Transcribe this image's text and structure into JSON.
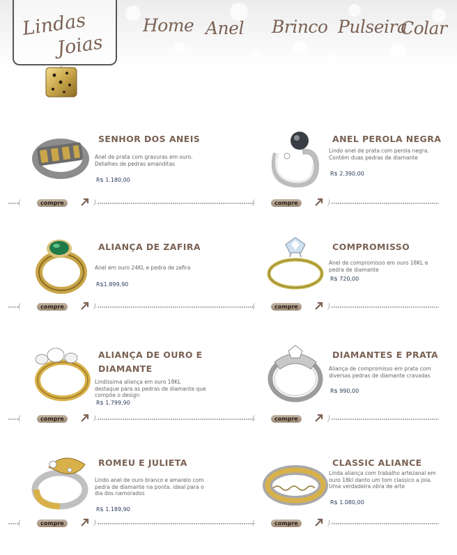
{
  "logo": {
    "line1": "Lindas",
    "line2": "Joias"
  },
  "nav": {
    "home": "Home",
    "anel": "Anel",
    "brinco": "Brinco",
    "pulseira": "Pulseira",
    "colar": "Colar"
  },
  "ui": {
    "buy_label": "compre",
    "arrow_icon": "arrow-up-right-icon",
    "accent_color": "#7a6254"
  },
  "products": [
    {
      "name": "SENHOR DOS ANEIS",
      "description": "Anel de prata com gravuras em ouro. Detalhes de pedras amanditas",
      "price": "R$  1.180,00"
    },
    {
      "name": "ANEL PEROLA NEGRA",
      "description": "Lindo anel de prata com perola negra. Contém duas pedras de diamante",
      "price": "R$  2.390,00"
    },
    {
      "name": "ALIANÇA DE ZAFIRA",
      "description": "Anel em ouro 24KL e pedra de zafira",
      "price": "R$1.899,90"
    },
    {
      "name": "COMPROMISSO",
      "description": "Anel de compromisso em ouro 18KL e pedra de diamante",
      "price": "R$ 720,00"
    },
    {
      "name": "ALIANÇA DE OURO E DIAMANTE",
      "description": "Lindíssima aliança em ouro 18KL destaque para as pedras de diamante que compõe o design",
      "price": "R$  1.799,90"
    },
    {
      "name": "DIAMANTES E PRATA",
      "description": "Aliança de compromisso em prata com diversas pedras de diamante cravadas",
      "price": "R$  990,00"
    },
    {
      "name": "ROMEU E JULIETA",
      "description": "Lindo anel de ouro branco e amarelo com pedra de diamante na ponta. ideal para o dia dos namorados",
      "price": "R$  1.189,90"
    },
    {
      "name": "CLASSIC ALIANCE",
      "description": "Linda aliança com trabalho artezanal em ouro 18kl danto um tom classico a joia. Uma verdadeira obra de arte",
      "price": "R$  1.080,00"
    }
  ]
}
